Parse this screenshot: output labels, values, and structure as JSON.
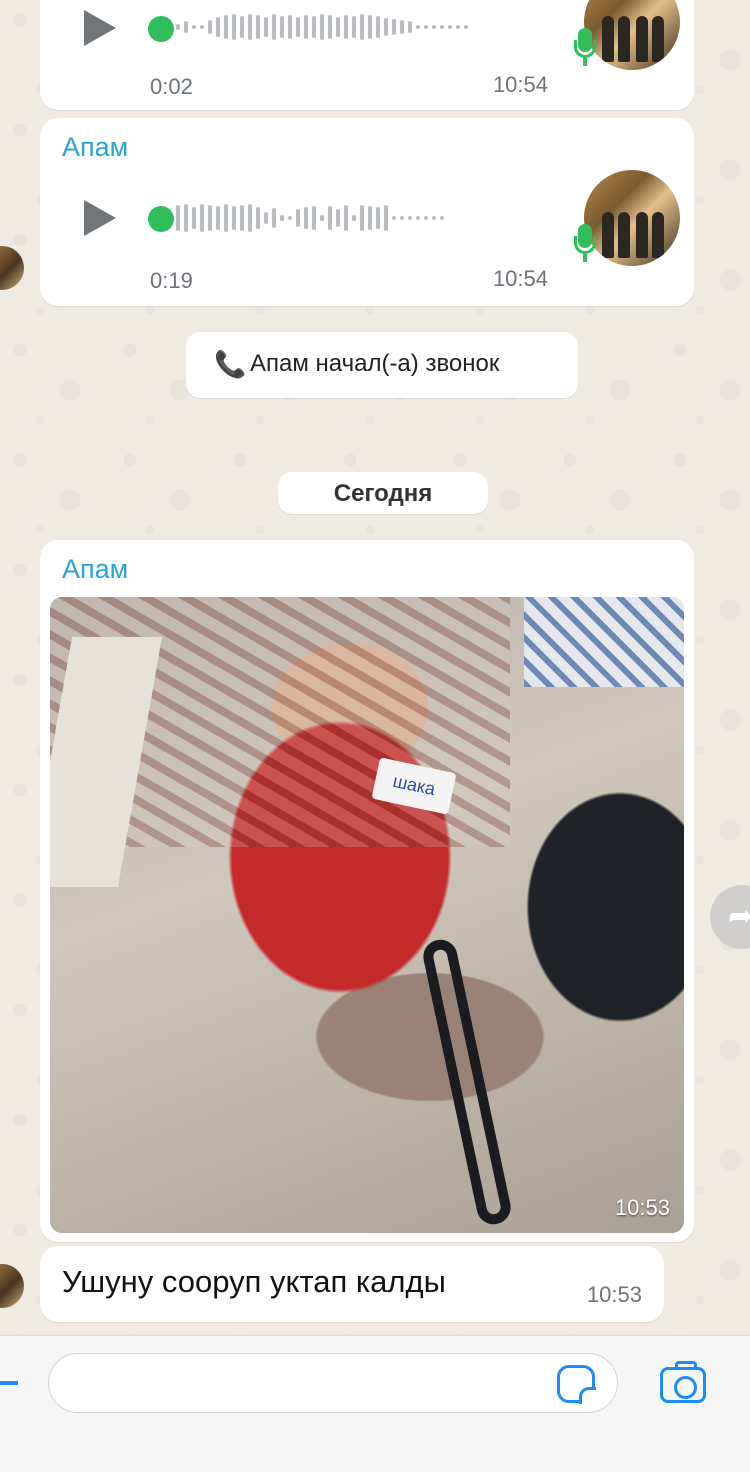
{
  "messages": {
    "voice1": {
      "duration": "0:02",
      "time": "10:54"
    },
    "voice2": {
      "sender": "Апам",
      "duration": "0:19",
      "time": "10:54"
    },
    "call_notice": {
      "icon": "phone-icon",
      "text": "Апам начал(-а) звонок"
    },
    "date_divider": "Сегодня",
    "photo_msg": {
      "sender": "Апам",
      "time": "10:53",
      "photo_text": "шака"
    },
    "text_msg": {
      "text": "Ушуну сооруп уктап калды",
      "time": "10:53"
    }
  },
  "colors": {
    "sender": "#2aa3d6",
    "accent": "#1d8cf8",
    "voice_green": "#2fbe5a"
  },
  "composer": {
    "placeholder": "",
    "icons": [
      "sticker-icon",
      "camera-icon"
    ]
  }
}
